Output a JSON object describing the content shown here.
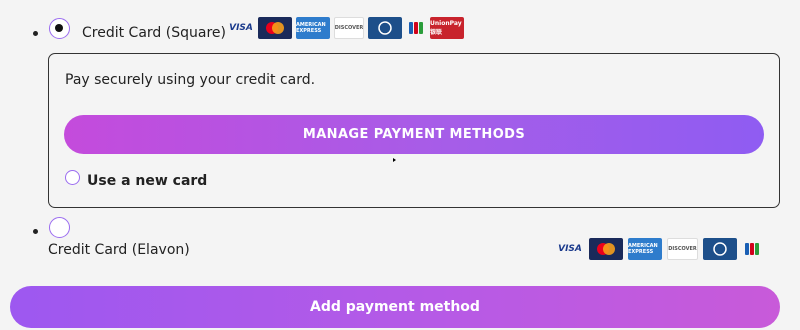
{
  "payment_options": [
    {
      "label": "Credit Card (Square)",
      "selected": true,
      "logos": [
        "visa",
        "mastercard",
        "amex",
        "discover",
        "diners",
        "jcb",
        "unionpay"
      ],
      "panel": {
        "description": "Pay securely using your credit card.",
        "manage_button": "MANAGE PAYMENT METHODS",
        "new_card_label": "Use a new card",
        "new_card_selected": false
      }
    },
    {
      "label": "Credit Card (Elavon)",
      "selected": false,
      "logos": [
        "visa",
        "mastercard",
        "amex",
        "discover",
        "diners",
        "jcb"
      ]
    }
  ],
  "logo_text": {
    "visa": "VISA",
    "amex": "AMERICAN EXPRESS",
    "discover": "DISCOVER",
    "unionpay": "UnionPay 银联"
  },
  "add_button": "Add payment method",
  "colors": {
    "accent_purple": "#9b6cf0",
    "button_gradient_start": "#c44bdc",
    "button_gradient_end": "#8f5cf2"
  }
}
